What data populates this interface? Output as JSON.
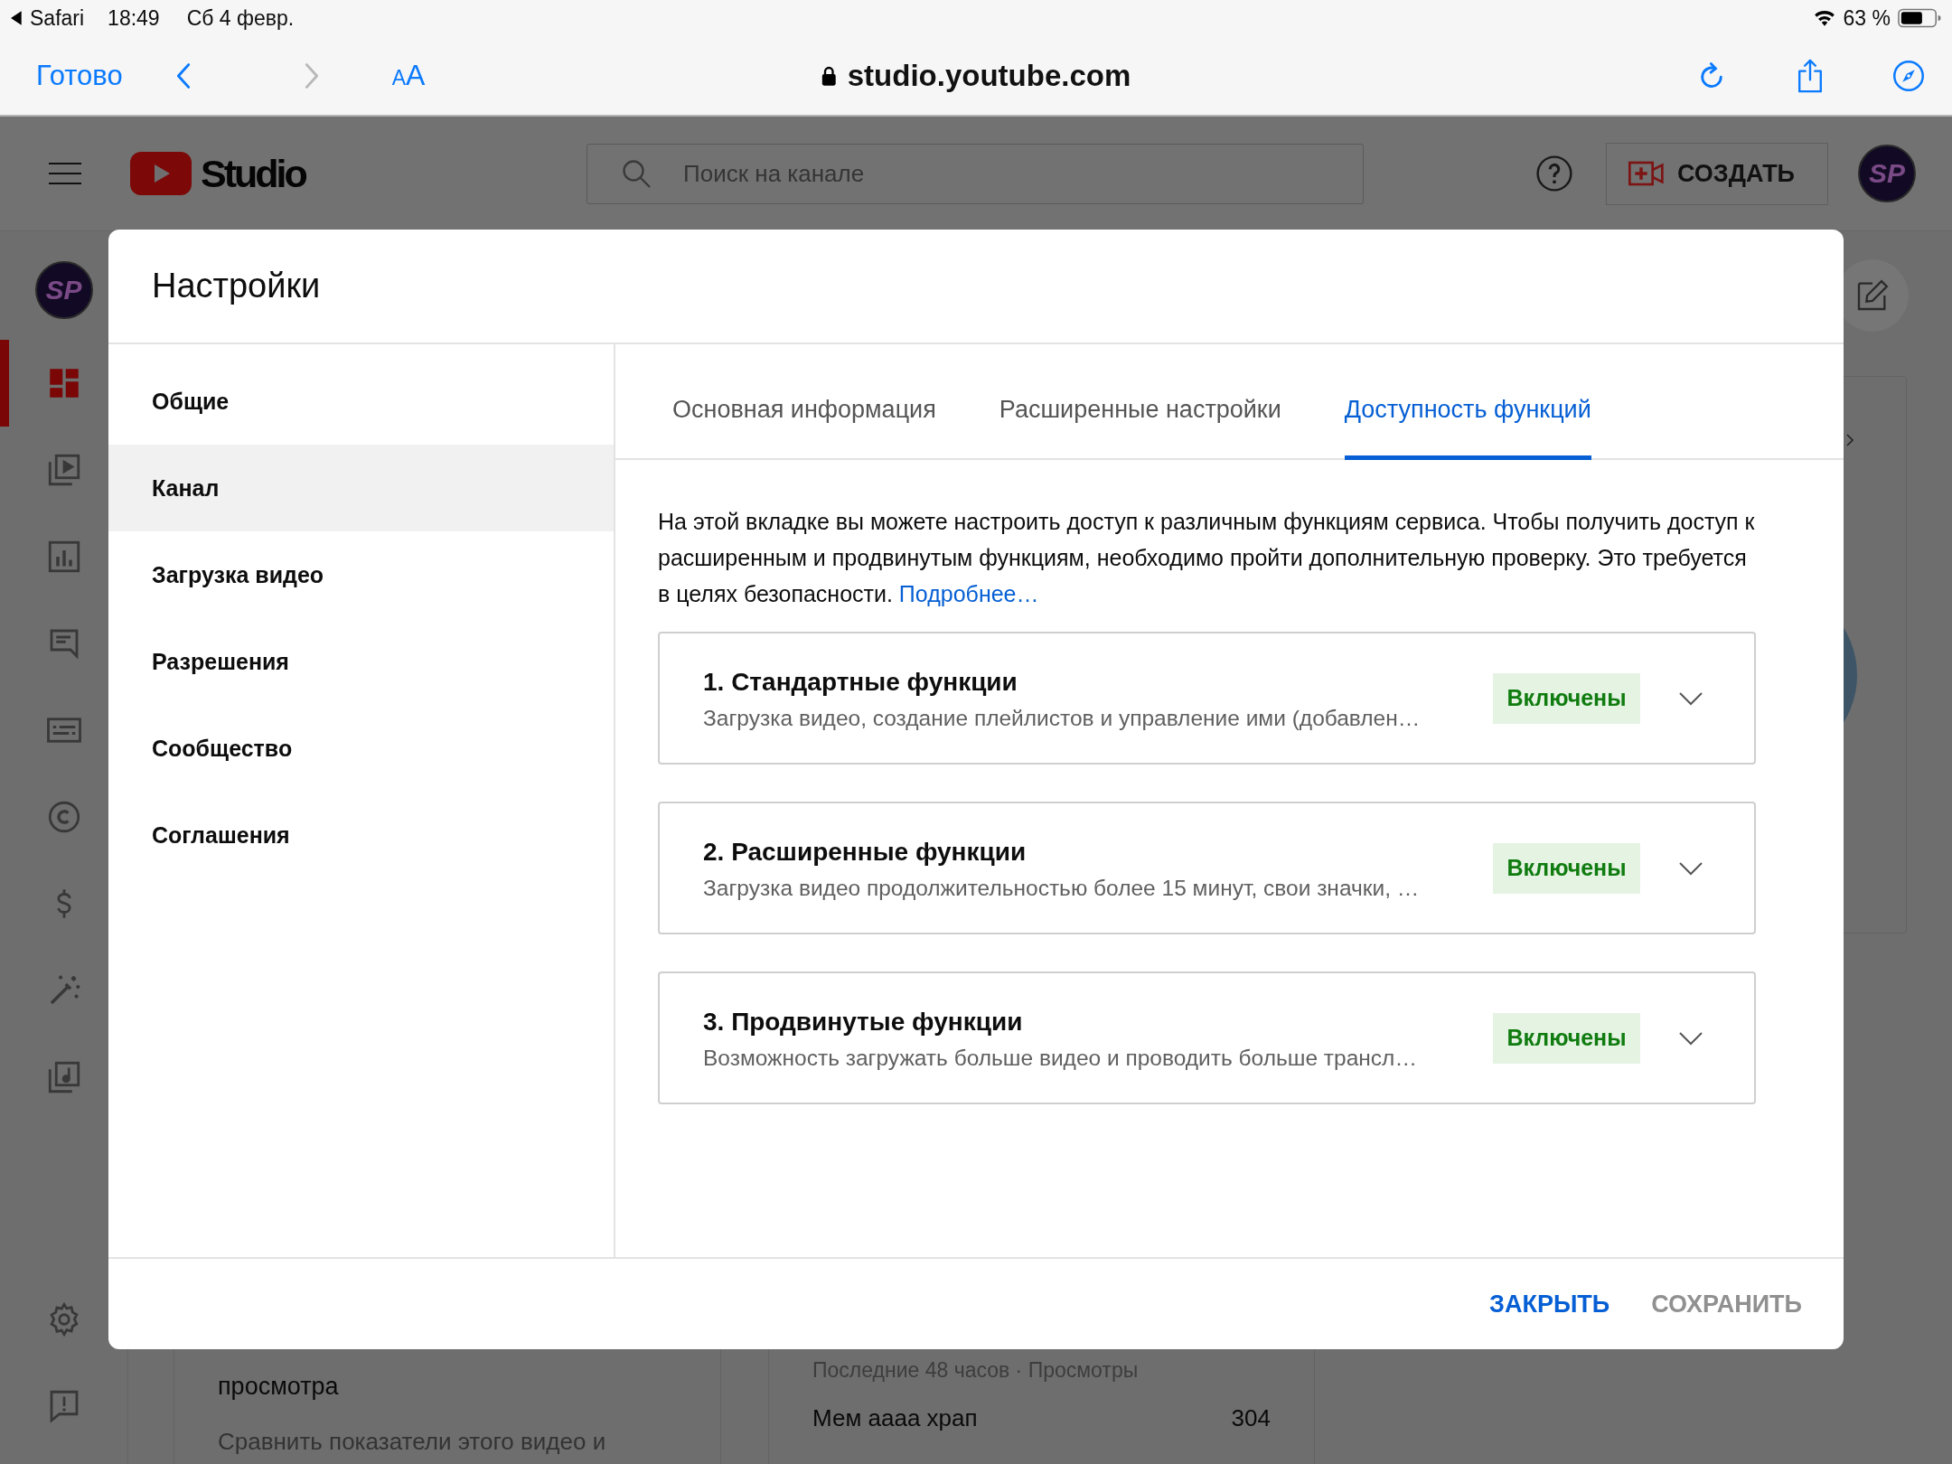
{
  "status_bar": {
    "app": "Safari",
    "time": "18:49",
    "date": "Сб 4 февр.",
    "battery": "63 %"
  },
  "browser": {
    "done": "Готово",
    "back": {
      "disabled": false
    },
    "forward": {
      "disabled": true
    },
    "text_size": "AA",
    "url": "studio.youtube.com"
  },
  "studio_header": {
    "logo": "Studio",
    "search_placeholder": "Поиск на канале",
    "create": "СОЗДАТЬ",
    "avatar": "SP"
  },
  "rail": {
    "avatar": "SP",
    "items": [
      {
        "kind": "dashboard",
        "selected": true
      },
      {
        "kind": "content",
        "selected": false
      },
      {
        "kind": "analytics",
        "selected": false
      },
      {
        "kind": "comments",
        "selected": false
      },
      {
        "kind": "subtitles",
        "selected": false
      },
      {
        "kind": "copyright",
        "selected": false
      },
      {
        "kind": "earn",
        "selected": false
      },
      {
        "kind": "customization",
        "selected": false
      },
      {
        "kind": "audio_library",
        "selected": false
      }
    ],
    "bottom_items": [
      {
        "kind": "settings",
        "selected": false
      },
      {
        "kind": "feedback",
        "selected": false
      }
    ]
  },
  "background": {
    "metric_card": {
      "title": "просмотра",
      "text": "Сравнить показатели этого видео и"
    },
    "views_card": {
      "caption": "Последние 48 часов · Просмотры",
      "rows": [
        {
          "title": "Мем аааа храп",
          "value": "304"
        }
      ]
    }
  },
  "dialog": {
    "title": "Настройки",
    "nav": [
      {
        "label": "Общие",
        "selected": false
      },
      {
        "label": "Канал",
        "selected": true
      },
      {
        "label": "Загрузка видео",
        "selected": false
      },
      {
        "label": "Разрешения",
        "selected": false
      },
      {
        "label": "Сообщество",
        "selected": false
      },
      {
        "label": "Соглашения",
        "selected": false
      }
    ],
    "tabs": [
      {
        "label": "Основная информация",
        "selected": false
      },
      {
        "label": "Расширенные настройки",
        "selected": false
      },
      {
        "label": "Доступность функций",
        "selected": true
      }
    ],
    "description": "На этой вкладке вы можете настроить доступ к различным функциям сервиса. Чтобы получить доступ к расширенным и продвинутым функциям, необходимо пройти дополнительную проверку. Это требуется в целях безопасности.",
    "link": "Подробнее…",
    "features": [
      {
        "title": "1. Стандартные функции",
        "summary": "Загрузка видео, создание плейлистов и управление ими (добавлен…",
        "status": "Включены",
        "expanded": false
      },
      {
        "title": "2. Расширенные функции",
        "summary": "Загрузка видео продолжительностью более 15 минут, свои значки, …",
        "status": "Включены",
        "expanded": false
      },
      {
        "title": "3. Продвинутые функции",
        "summary": "Возможность загружать больше видео и проводить больше трансл…",
        "status": "Включены",
        "expanded": false
      }
    ],
    "buttons": [
      {
        "label": "ЗАКРЫТЬ",
        "disabled": false
      },
      {
        "label": "СОХРАНИТЬ",
        "disabled": true
      }
    ]
  }
}
